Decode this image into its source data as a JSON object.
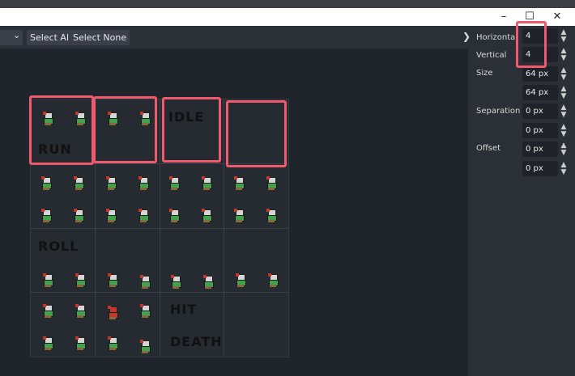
{
  "window": {
    "minimize": "–",
    "maximize": "☐",
    "close": "✕"
  },
  "toolbar": {
    "select_all": "Select All",
    "select_none": "Select None",
    "left_chevron": "⌄",
    "expand": "❯"
  },
  "sheet": {
    "labels": {
      "run": "RUN",
      "idle": "IDLE",
      "roll": "ROLL",
      "hit": "HIT",
      "death": "DEATH"
    }
  },
  "panel": {
    "horizontal": {
      "label": "Horizonta",
      "value": "4"
    },
    "vertical": {
      "label": "Vertical",
      "value": "4"
    },
    "size": {
      "label": "Size",
      "x": "64 px",
      "y": "64 px"
    },
    "separation": {
      "label": "Separation",
      "x": "0 px",
      "y": "0 px"
    },
    "offset": {
      "label": "Offset",
      "x": "0 px",
      "y": "0 px"
    }
  },
  "colors": {
    "highlight": "#ef5a6e",
    "panel_bg": "#2b2f36",
    "canvas_bg": "#20242b"
  },
  "icons": [
    "minimize-icon",
    "maximize-icon",
    "close-icon",
    "chevron-down-icon",
    "chevron-right-icon",
    "spinner-icon",
    "sprite-icon"
  ]
}
